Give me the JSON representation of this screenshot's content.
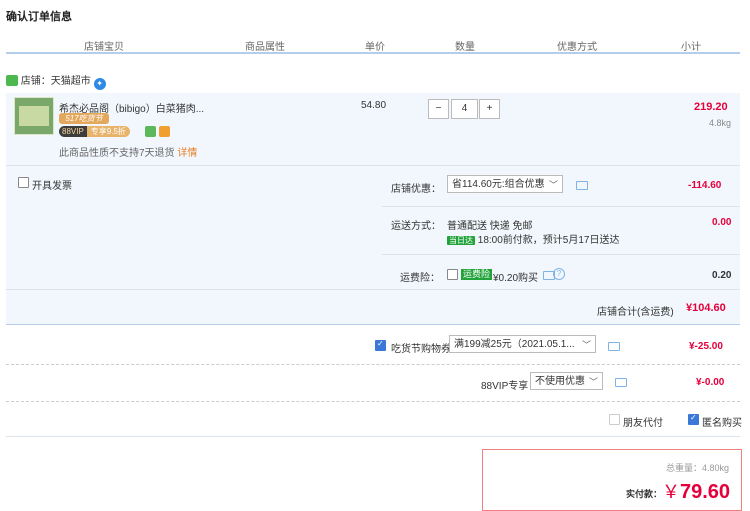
{
  "page_title": "确认订单信息",
  "columns": [
    "店铺宝贝",
    "商品属性",
    "单价",
    "数量",
    "优惠方式",
    "小计"
  ],
  "shop": {
    "label": "店铺：",
    "name": "天猫超市"
  },
  "item": {
    "name": "希杰必品阁（bibigo）白菜猪肉...",
    "promo_tag": "517吃货节",
    "vip_tag_a": "88VIP",
    "vip_tag_b": "专享9.5折",
    "no_return_text": "此商品性质不支持7天退货",
    "no_return_more": "详情",
    "unit_price": "54.80",
    "quantity": "4",
    "qty_minus": "−",
    "qty_plus": "+",
    "subtotal": "219.20",
    "weight": "4.8kg"
  },
  "invoice": {
    "label": "开具发票"
  },
  "shop_discount": {
    "label": "店铺优惠：",
    "selected": "省114.60元:组合优惠",
    "amount": "-114.60"
  },
  "shipping": {
    "label": "运送方式：",
    "method": "普通配送 快递 免邮",
    "tag": "当日达",
    "desc": "18:00前付款，预计5月17日送达",
    "amount": "0.00"
  },
  "freight_insurance": {
    "label": "运费险：",
    "tag": "运费险",
    "price": "¥0.20购买",
    "amount": "0.20"
  },
  "shop_total": {
    "label": "店铺合计(含运费)",
    "amount": "¥104.60"
  },
  "coupon": {
    "label": "吃货节购物券",
    "selected": "满199减25元（2021.05.1...",
    "amount": "¥-25.00",
    "checked": true
  },
  "vip": {
    "label": "88VIP专享",
    "selected": "不使用优惠",
    "amount": "¥-0.00"
  },
  "friend_pay": {
    "label": "朋友代付",
    "checked": false
  },
  "anonymous": {
    "label": "匿名购买",
    "checked": true
  },
  "summary": {
    "weight_label": "总重量：",
    "weight_value": "4.80kg",
    "pay_label": "实付款：",
    "currency": "￥",
    "pay_value": "79.60"
  },
  "colors": {
    "red": "#e4003a",
    "blue_line": "#b3cdea",
    "panel_bg": "#f2f7fd",
    "green": "#21a33a"
  }
}
